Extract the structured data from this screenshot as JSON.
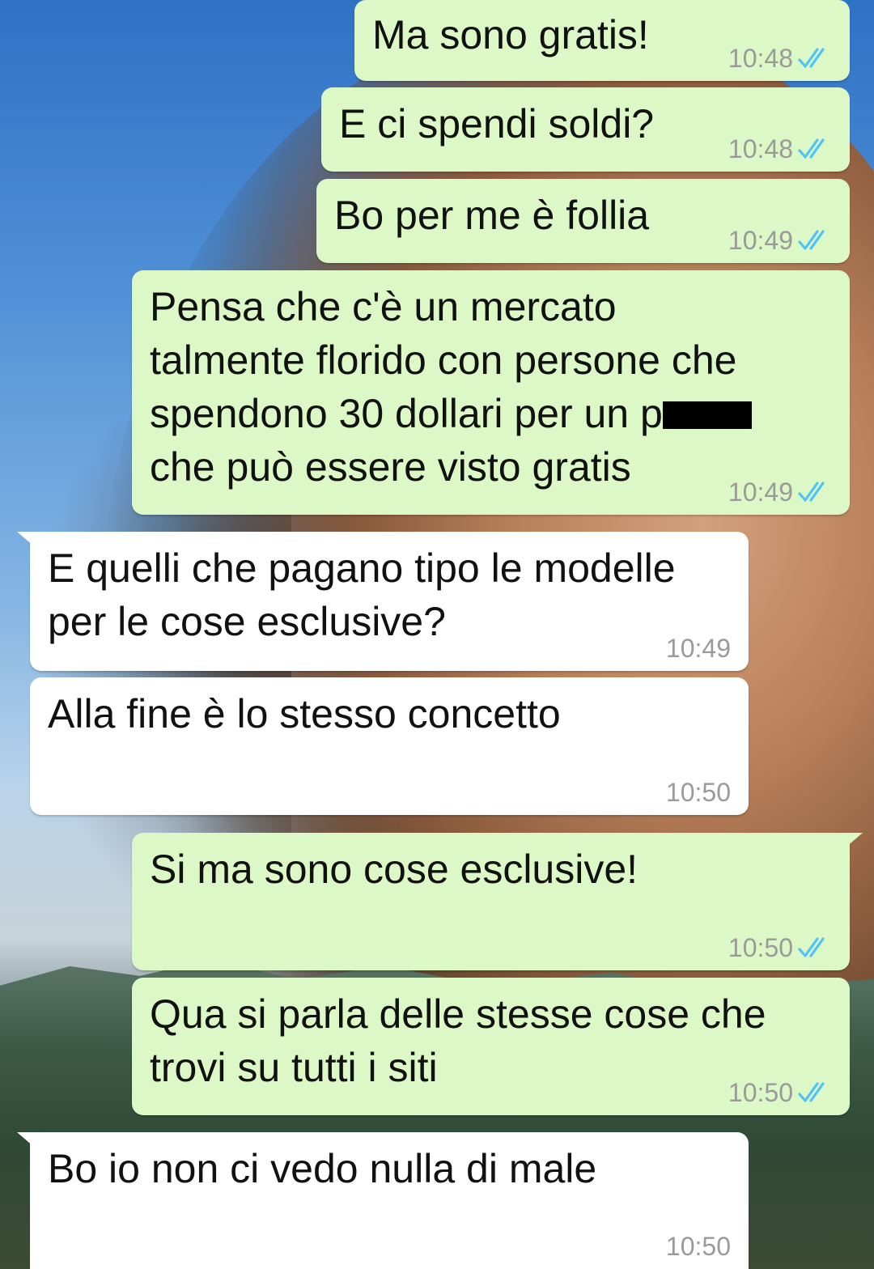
{
  "colors": {
    "outgoing_bubble": "#dcf8c6",
    "incoming_bubble": "#ffffff",
    "read_tick": "#4fc3f7",
    "time_text": "#9a9a9a"
  },
  "messages": [
    {
      "direction": "out",
      "text": "Ma sono gratis!",
      "time": "10:48",
      "status_icon": "double-check-read-icon"
    },
    {
      "direction": "out",
      "text": "E ci spendi soldi?",
      "time": "10:48",
      "status_icon": "double-check-read-icon"
    },
    {
      "direction": "out",
      "text": "Bo per me è follia",
      "time": "10:49",
      "status_icon": "double-check-read-icon"
    },
    {
      "direction": "out",
      "text_line1": "Pensa che c'è un mercato",
      "text_line2": "talmente florido con persone che",
      "text_line3": "spendono 30 dollari per un p",
      "text_line4": "che può essere visto gratis",
      "time": "10:49",
      "status_icon": "double-check-read-icon"
    },
    {
      "direction": "in",
      "text_line1": "E quelli che pagano tipo le modelle",
      "text_line2": "per le cose esclusive?",
      "time": "10:49"
    },
    {
      "direction": "in",
      "text": "Alla fine è lo stesso concetto",
      "time": "10:50"
    },
    {
      "direction": "out",
      "text": "Si ma sono cose esclusive!",
      "time": "10:50",
      "status_icon": "double-check-read-icon"
    },
    {
      "direction": "out",
      "text_line1": "Qua si parla delle stesse cose che",
      "text_line2": "trovi su tutti i siti",
      "time": "10:50",
      "status_icon": "double-check-read-icon"
    },
    {
      "direction": "in",
      "text": "Bo io non ci vedo nulla di male",
      "time": "10:50"
    }
  ]
}
